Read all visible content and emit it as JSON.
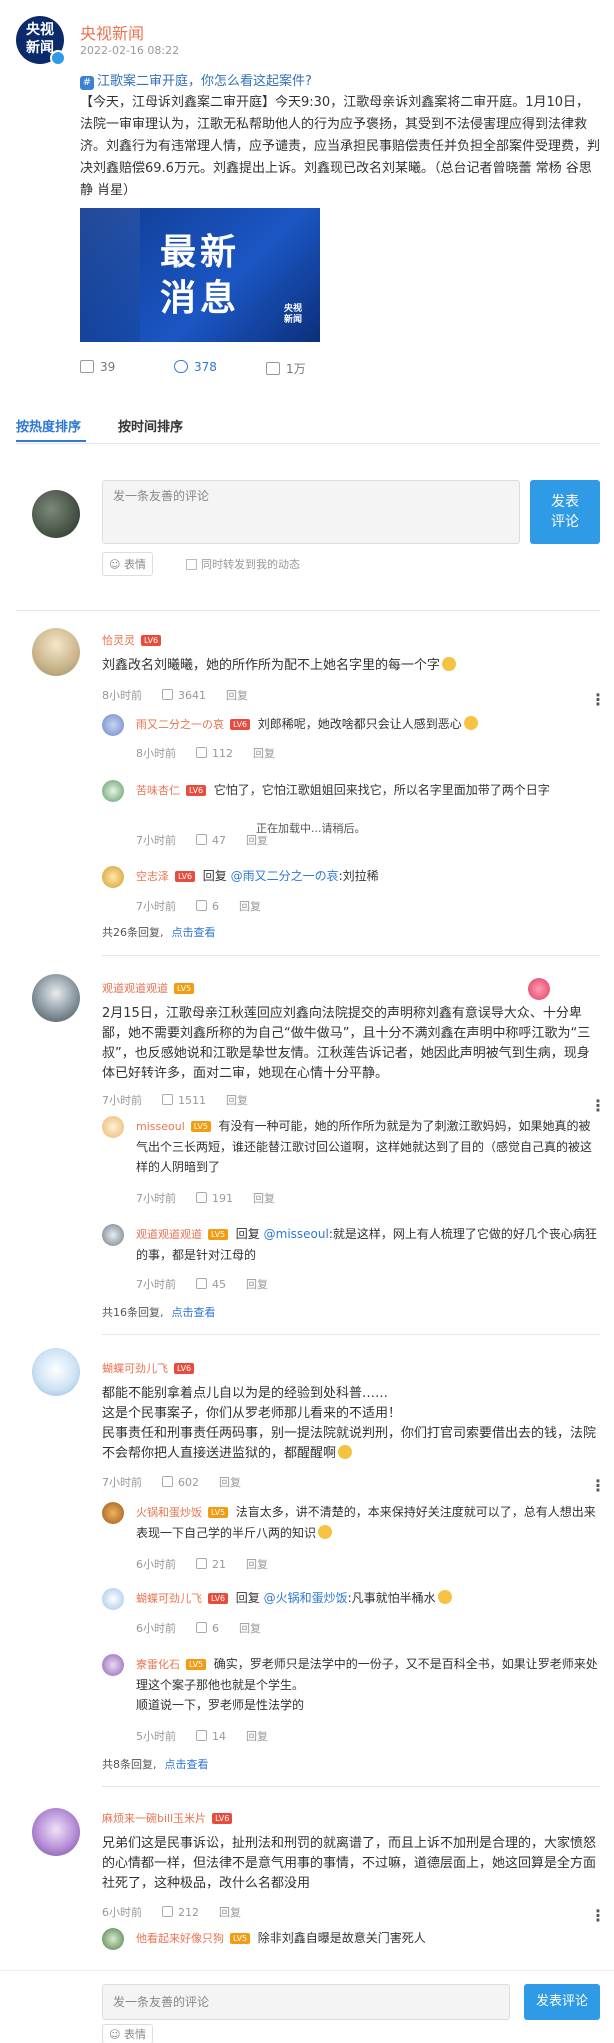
{
  "post": {
    "author": "央视新闻",
    "avatar_text_1": "央视",
    "avatar_text_2": "新闻",
    "date": "2022-02-16 08:22",
    "topic": "江歌案二审开庭，你怎么看这起案件?",
    "body": "【今天，江母诉刘鑫案二审开庭】今天9:30，江歌母亲诉刘鑫案将二审开庭。1月10日，法院一审审理认为，江歌无私帮助他人的行为应予褒扬，其受到不法侵害理应得到法律救济。刘鑫行为有违常理人情，应予谴责，应当承担民事赔偿责任并负担全部案件受理费，判决刘鑫赔偿69.6万元。刘鑫提出上诉。刘鑫现已改名刘某曦。（总台记者曾晓蕾 常杨 谷思静 肖星）",
    "image_text": "最新\n消息",
    "image_logo": "央视\n新闻",
    "shares": "39",
    "comments": "378",
    "likes": "1万"
  },
  "tabs": {
    "hot": "按热度排序",
    "time": "按时间排序"
  },
  "composer": {
    "placeholder": "发一条友善的评论",
    "send": "发表\n评论",
    "emoji": "表情",
    "also_post": "同时转发到我的动态"
  },
  "bottom_composer": {
    "placeholder": "发一条友善的评论",
    "send": "发表评论",
    "emoji": "表情"
  },
  "loading": "正在加载中...请稍后。",
  "reply_label": "回复",
  "comments": [
    {
      "user": "恰灵灵",
      "level": "LV6",
      "text": "刘鑫改名刘曦曦，她的所作所为配不上她名字里的每一个字",
      "time": "8小时前",
      "likes": "3641",
      "replies": [
        {
          "user": "雨又二分之一の哀",
          "level": "LV6",
          "text": "刘郎稀呢，她改啥都只会让人感到恶心",
          "time": "8小时前",
          "likes": "112"
        },
        {
          "user": "苦味杏仁",
          "level": "LV6",
          "text": "它怕了，它怕江歌姐姐回来找它，所以名字里面加带了两个日字",
          "time": "7小时前",
          "likes": "47"
        },
        {
          "user": "空志泽",
          "level": "LV6",
          "prefix": "回复",
          "mention": "@雨又二分之一の哀",
          "text": ":刘拉稀",
          "time": "7小时前",
          "likes": "6"
        }
      ],
      "reply_total": "共26条回复,",
      "view": "点击查看"
    },
    {
      "user": "观道观道观道",
      "level": "LV5",
      "text": "2月15日，江歌母亲江秋莲回应刘鑫向法院提交的声明称刘鑫有意误导大众、十分卑鄙，她不需要刘鑫所称的为自己“做牛做马”，且十分不满刘鑫在声明中称呼江歌为“三叔”，也反感她说和江歌是挚世友情。江秋莲告诉记者，她因此声明被气到生病，现身体已好转许多，面对二审，她现在心情十分平静。",
      "time": "7小时前",
      "likes": "1511",
      "replies": [
        {
          "user": "misseoul",
          "level": "LV5",
          "text": "有没有一种可能，她的所作所为就是为了刺激江歌妈妈，如果她真的被气出个三长两短，谁还能替江歌讨回公道啊，这样她就达到了目的（感觉自己真的被这样的人阴暗到了",
          "time": "7小时前",
          "likes": "191"
        },
        {
          "user": "观道观道观道",
          "level": "LV5",
          "prefix": "回复",
          "mention": "@misseoul",
          "text": ":就是这样，网上有人梳理了它做的好几个丧心病狂的事，都是针对江母的",
          "time": "7小时前",
          "likes": "45"
        }
      ],
      "reply_total": "共16条回复,",
      "view": "点击查看"
    },
    {
      "user": "蝴蝶可劲儿飞",
      "level": "LV6",
      "text": "都能不能别拿着点儿自以为是的经验到处科普……\n这是个民事案子，你们从罗老师那儿看来的不适用！\n民事责任和刑事责任两码事，别一提法院就说判刑，你们打官司索要借出去的钱，法院不会帮你把人直接送进监狱的，都醒醒啊",
      "time": "7小时前",
      "likes": "602",
      "replies": [
        {
          "user": "火锅和蛋炒饭",
          "level": "LV5",
          "text": "法盲太多，讲不清楚的，本来保持好关注度就可以了，总有人想出来表现一下自己学的半斤八两的知识",
          "time": "6小时前",
          "likes": "21"
        },
        {
          "user": "蝴蝶可劲儿飞",
          "level": "LV6",
          "prefix": "回复",
          "mention": "@火锅和蛋炒饭",
          "text": ":凡事就怕半桶水",
          "time": "6小时前",
          "likes": "6"
        },
        {
          "user": "寮雷化石",
          "level": "LV5",
          "text": "确实，罗老师只是法学中的一份子，又不是百科全书，如果让罗老师来处理这个案子那他也就是个学生。\n顺道说一下，罗老师是性法学的",
          "time": "5小时前",
          "likes": "14"
        }
      ],
      "reply_total": "共8条回复,",
      "view": "点击查看"
    },
    {
      "user": "麻烦来一碗bill玉米片",
      "level": "LV6",
      "text": "兄弟们这是民事诉讼，扯刑法和刑罚的就离谱了，而且上诉不加刑是合理的，大家愤怒的心情都一样，但法律不是意气用事的事情，不过嘛，道德层面上，她这回算是全方面社死了，这种极品，改什么名都没用",
      "time": "6小时前",
      "likes": "212",
      "replies": [
        {
          "user": "他看起来好像只狗",
          "level": "LV5",
          "text": "除非刘鑫自曝是故意关门害死人",
          "time": "",
          "likes": ""
        }
      ]
    }
  ],
  "colors": {
    "accent": "#2f78d6",
    "name": "#eb7350",
    "send": "#2f9ae6"
  }
}
